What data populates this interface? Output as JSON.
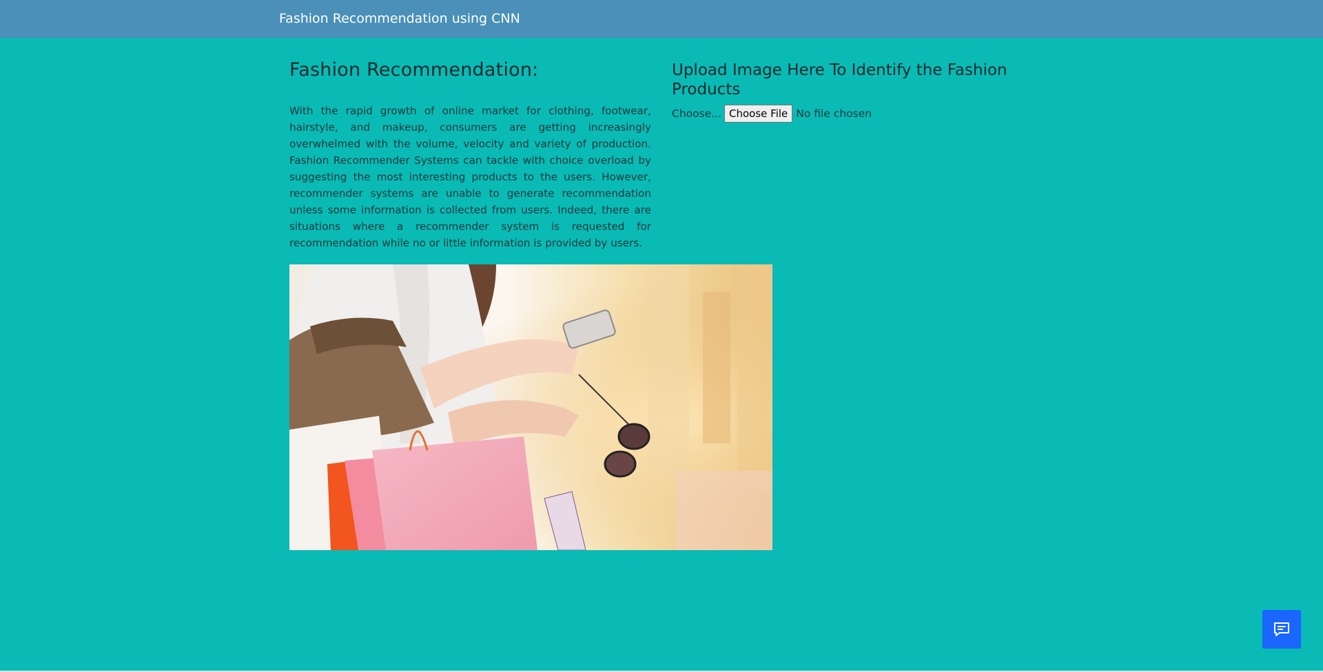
{
  "navbar": {
    "brand": "Fashion Recommendation using CNN"
  },
  "intro": {
    "title": "Fashion Recommendation:",
    "description": "With the rapid growth of online market for clothing, footwear, hairstyle, and makeup, consumers are getting increasingly overwhelmed with the volume, velocity and variety of production. Fashion Recommender Systems can tackle with choice overload by suggesting the most interesting products to the users. However, recommender systems are unable to generate recommendation unless some information is collected from users. Indeed, there are situations where a recommender system is requested for recommendation while no or little information is provided by users."
  },
  "upload": {
    "title": "Upload Image Here To Identify the Fashion Products",
    "label": "Choose...",
    "button_label": "Choose File",
    "status": "No file chosen"
  },
  "chat": {
    "icon": "chat-icon"
  },
  "colors": {
    "background": "#0abab5",
    "navbar": "#4a90b8",
    "chat_button": "#1a66ff"
  }
}
